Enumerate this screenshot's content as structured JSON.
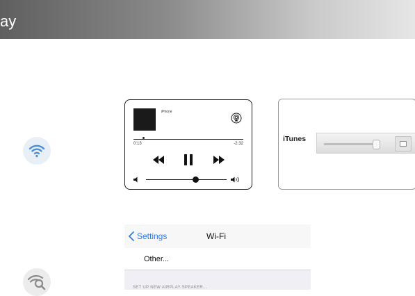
{
  "header": {
    "title": "ay"
  },
  "player": {
    "device_name": "iPhone",
    "time_elapsed": "0:13",
    "time_remaining": "-2:32",
    "progress": 0.09,
    "volume": 0.62
  },
  "itunes": {
    "label": "iTunes"
  },
  "wifi_settings": {
    "back_label": "Settings",
    "title": "Wi-Fi",
    "other_label": "Other...",
    "section_header": "SET UP NEW AIRPLAY SPEAKER..."
  },
  "colors": {
    "ios_blue": "#2f7bde",
    "wifi_icon": "#4a90d9",
    "wifi_search_icon": "#8a8a8a"
  },
  "icons": {
    "wifi": "wifi-icon",
    "wifi_search": "wifi-search-icon",
    "airplay": "airplay-icon",
    "rewind": "rewind-icon",
    "pause": "pause-icon",
    "forward": "forward-icon",
    "volume_min": "volume-min-icon",
    "volume_max": "volume-max-icon",
    "back": "chevron-left-icon"
  }
}
